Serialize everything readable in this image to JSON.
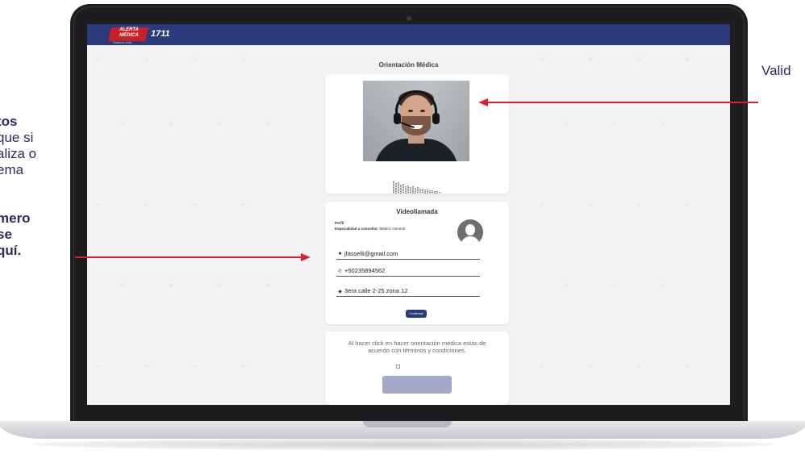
{
  "annotations": {
    "left_lines": [
      {
        "text": "tos",
        "bold": true
      },
      {
        "text": "que si",
        "bold": false
      },
      {
        "text": "aliza o",
        "bold": false
      },
      {
        "text": "ema",
        "bold": false
      },
      {
        "text": ",",
        "bold": false
      },
      {
        "text": "",
        "bold": false
      },
      {
        "text": "mero",
        "bold": true
      },
      {
        "text": "se",
        "bold": true
      },
      {
        "text": "quí.",
        "bold": true
      }
    ],
    "right_text": "Valid"
  },
  "app": {
    "logo_line1": "ALERTA",
    "logo_line2": "MÉDICA",
    "logo_number": "1711",
    "logo_tagline": "Salva tu vida",
    "page_title": "Orientación Médica"
  },
  "videollamada": {
    "title": "Videollamada",
    "perfil_label": "Perfil",
    "especialidad_label": "Especialidad a consultar:",
    "especialidad_value": "Médico General",
    "email": "jfasselli@gmail.com",
    "phone": "+50235894562",
    "address": "3era calle 2-25 zona 12",
    "confirm_label": "Confirmar"
  },
  "terms": {
    "text": "Al hacer click en hacer orientación médica estás de acuerdo con términos y condiciones."
  },
  "colors": {
    "brand_navy": "#2b3a7a",
    "brand_red": "#c8202b",
    "arrow_red": "#d9212e",
    "annotation_text": "#2d2a5e"
  }
}
